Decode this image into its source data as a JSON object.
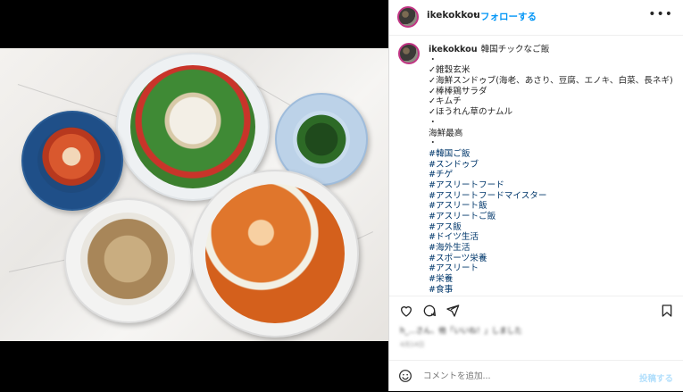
{
  "header": {
    "username": "ikekokkou",
    "separator": "•",
    "follow_label": "フォローする",
    "more_icon": "more-horizontal-icon"
  },
  "caption": {
    "username": "ikekokkou",
    "title": "韓国チックなご飯",
    "lines": [
      "・",
      "✓雑穀玄米",
      "✓海鮮スンドゥブ(海老、あさり、豆腐、エノキ、白菜、長ネギ)",
      "✓棒棒鶏サラダ",
      "✓キムチ",
      "✓ほうれん草のナムル",
      "・",
      "海鮮最高",
      "・"
    ],
    "hashtags": [
      "#韓国ご飯",
      "#スンドゥブ",
      "#チゲ",
      "#アスリートフード",
      "#アスリートフードマイスター",
      "#アスリート飯",
      "#アスリートご飯",
      "#アス飯",
      "#ドイツ生活",
      "#海外生活",
      "#スポーツ栄養",
      "#アスリート",
      "#栄養",
      "#食事"
    ]
  },
  "actions": {
    "like_icon": "heart-icon",
    "comment_icon": "comment-icon",
    "share_icon": "share-icon",
    "save_icon": "bookmark-icon"
  },
  "likes_text": "h_...さん、他「いいね！」しました",
  "date_text": "4月14日",
  "comment": {
    "placeholder": "コメントを追加...",
    "post_label": "投稿する",
    "emoji_icon": "smile-icon"
  },
  "colors": {
    "accent": "#0095f6",
    "text": "#262626",
    "hashtag": "#00376b",
    "muted": "#8e8e8e"
  }
}
